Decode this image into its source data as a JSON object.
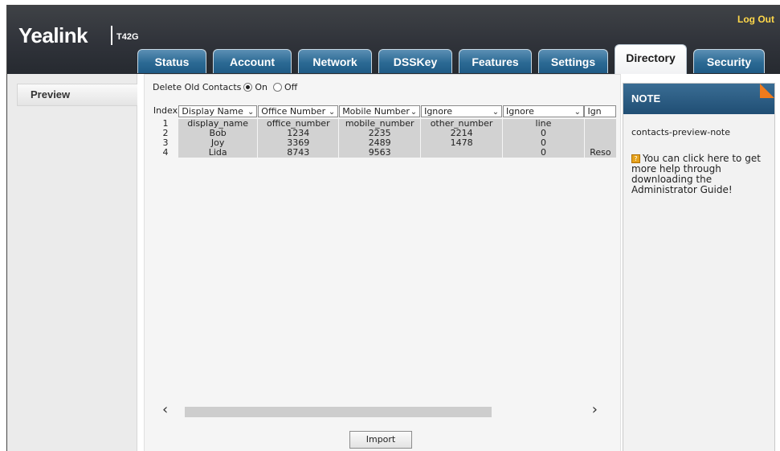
{
  "header": {
    "brand": "Yealink",
    "model": "T42G",
    "logout": "Log Out"
  },
  "tabs": [
    {
      "label": "Status"
    },
    {
      "label": "Account"
    },
    {
      "label": "Network"
    },
    {
      "label": "DSSKey"
    },
    {
      "label": "Features"
    },
    {
      "label": "Settings"
    },
    {
      "label": "Directory",
      "active": true
    },
    {
      "label": "Security"
    }
  ],
  "sidebar": {
    "items": [
      {
        "label": "Preview"
      }
    ]
  },
  "main": {
    "delete_old_contacts": {
      "label": "Delete Old Contacts",
      "on_label": "On",
      "off_label": "Off",
      "selected": "On"
    },
    "index_label": "Index",
    "column_selects": [
      "Display Name",
      "Office Number",
      "Mobile Number",
      "Ignore",
      "Ignore",
      "Ign"
    ],
    "rows": [
      {
        "index": "1",
        "cells": [
          "display_name",
          "office_number",
          "mobile_number",
          "other_number",
          "line",
          ""
        ]
      },
      {
        "index": "2",
        "cells": [
          "Bob",
          "1234",
          "2235",
          "2214",
          "0",
          ""
        ]
      },
      {
        "index": "3",
        "cells": [
          "Joy",
          "3369",
          "2489",
          "1478",
          "0",
          ""
        ]
      },
      {
        "index": "4",
        "cells": [
          "Lida",
          "8743",
          "9563",
          "",
          "0",
          "Reso"
        ]
      }
    ],
    "import_label": "Import"
  },
  "note": {
    "title": "NOTE",
    "text": "contacts-preview-note",
    "help": "You can click here to get more help through downloading the Administrator Guide!",
    "accent": "#f07b1d"
  }
}
